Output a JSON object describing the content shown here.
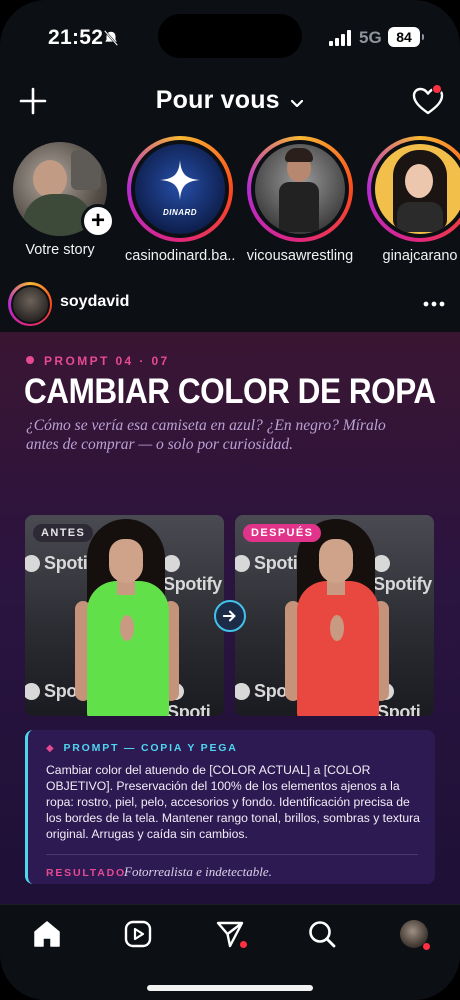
{
  "status_bar": {
    "time": "21:52",
    "network": "5G",
    "battery": "84"
  },
  "header": {
    "title": "Pour vous"
  },
  "stories": [
    {
      "label": "Votre story",
      "own": true
    },
    {
      "label": "casinodinard.ba...",
      "logo_text": "DINARD"
    },
    {
      "label": "vicousawrestling"
    },
    {
      "label": "ginajcarano"
    }
  ],
  "post": {
    "username": "soydavid",
    "content": {
      "tag": "PROMPT 04 · 07",
      "headline": "CAMBIAR COLOR DE ROPA",
      "subtitle": "¿Cómo se vería esa camiseta en azul? ¿En negro? Míralo antes de comprar — o solo por curiosidad.",
      "before_label": "ANTES",
      "after_label": "DESPUÉS",
      "brand_text": "Spotify",
      "brand_cut_left": "Spo",
      "brand_cut_right": "Spoti",
      "card_tag": "PROMPT — COPIA Y PEGA",
      "card_body": "Cambiar color del atuendo de [COLOR ACTUAL] a [COLOR OBJETIVO]. Preservación del 100% de los elementos ajenos a la ropa: rostro, piel, pelo, accesorios y fondo. Identificación precisa de los bordes de la tela. Mantener rango tonal, brillos, sombras y textura original. Arrugas y caída sin cambios.",
      "result_label": "RESULTADO",
      "result_text": "Fotorrealista e indetectable."
    }
  },
  "nav": [
    "home-icon",
    "reels-icon",
    "send-icon",
    "search-icon",
    "profile-avatar"
  ],
  "colors": {
    "accent_pink": "#e64a91",
    "accent_cyan": "#4fd5f0",
    "green_dress": "#62e04a",
    "red_dress": "#e94840"
  }
}
